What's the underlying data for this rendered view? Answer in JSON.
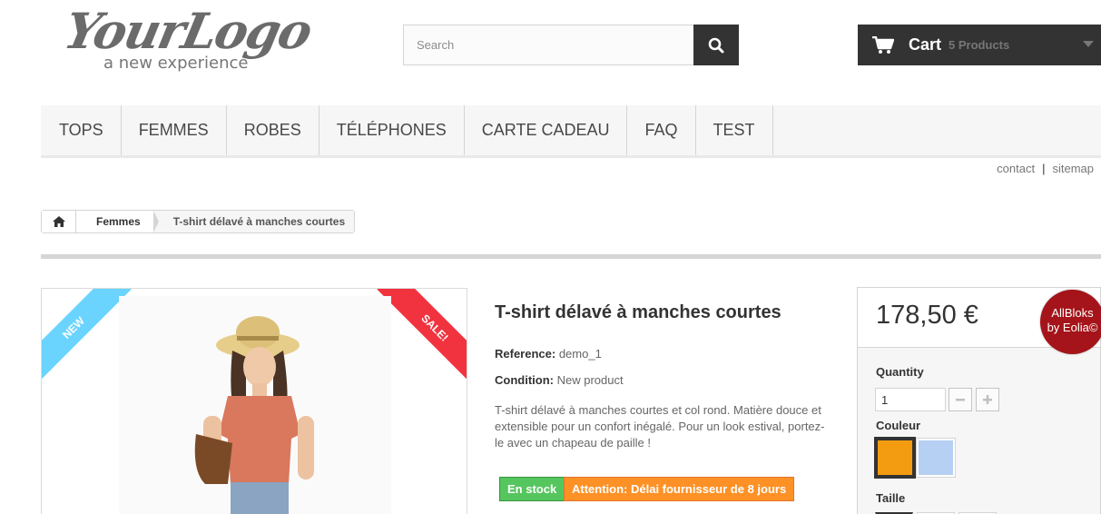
{
  "header": {
    "logo_main": "YourLogo",
    "logo_tagline": "a new experience",
    "search_placeholder": "Search",
    "cart_label": "Cart",
    "cart_count": "5 Products"
  },
  "menu": {
    "items": [
      "TOPS",
      "FEMMES",
      "ROBES",
      "TÉLÉPHONES",
      "CARTE CADEAU",
      "FAQ",
      "TEST"
    ]
  },
  "toplinks": {
    "contact": "contact",
    "sitemap": "sitemap"
  },
  "breadcrumb": {
    "category": "Femmes",
    "current": "T-shirt délavé à manches courtes"
  },
  "product": {
    "new_ribbon": "New",
    "sale_ribbon": "Sale!",
    "name": "T-shirt délavé à manches courtes",
    "reference_label": "Reference:",
    "reference_value": "demo_1",
    "condition_label": "Condition:",
    "condition_value": "New product",
    "description": "T-shirt délavé à manches courtes et col rond. Matière douce et extensible pour un confort inégalé. Pour un look estival, portez-le avec un chapeau de paille !",
    "stock_badge": "En stock",
    "delay_badge": "Attention: Délai fournisseur de 8 jours"
  },
  "buy": {
    "price": "178,50 €",
    "quantity_label": "Quantity",
    "quantity_value": "1",
    "color_label": "Couleur",
    "colors": [
      "#f39c11",
      "#b5d0f2"
    ],
    "size_label": "Taille"
  },
  "promo_badge": {
    "line1": "AllBloks",
    "line2": "by Eolia©"
  },
  "colors": {
    "dark": "#333333",
    "menu_bg": "#f6f6f6",
    "stock": "#55c65e",
    "warning": "#fe9126",
    "ribbon_new": "#6ad4ff",
    "ribbon_sale": "#f13340",
    "promo": "#a4141a"
  }
}
